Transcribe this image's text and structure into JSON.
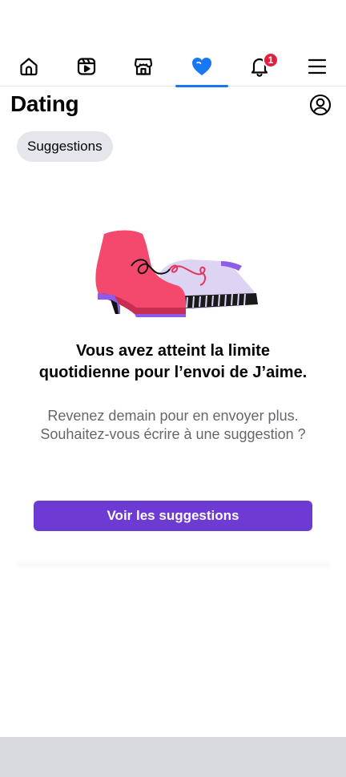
{
  "nav": {
    "items": [
      {
        "name": "home",
        "icon": "home-icon"
      },
      {
        "name": "video",
        "icon": "video-icon"
      },
      {
        "name": "marketplace",
        "icon": "marketplace-icon"
      },
      {
        "name": "dating",
        "icon": "heart-icon",
        "active": true
      },
      {
        "name": "notifications",
        "icon": "bell-icon",
        "badge": "1"
      },
      {
        "name": "menu",
        "icon": "menu-icon"
      }
    ],
    "notification_badge": "1",
    "accent_color": "#1877f2",
    "badge_color": "#e41e3f"
  },
  "header": {
    "title": "Dating",
    "profile_icon": "profile-icon"
  },
  "tabs": {
    "suggestions_label": "Suggestions"
  },
  "message": {
    "illustration": "shoes-illustration",
    "title": "Vous avez atteint la limite quotidienne pour l’envoi de J’aime.",
    "body": "Revenez demain pour en envoyer plus. Souhaitez-vous écrire à une suggestion ?"
  },
  "cta": {
    "label": "Voir les suggestions",
    "color": "#6d3bd4"
  }
}
